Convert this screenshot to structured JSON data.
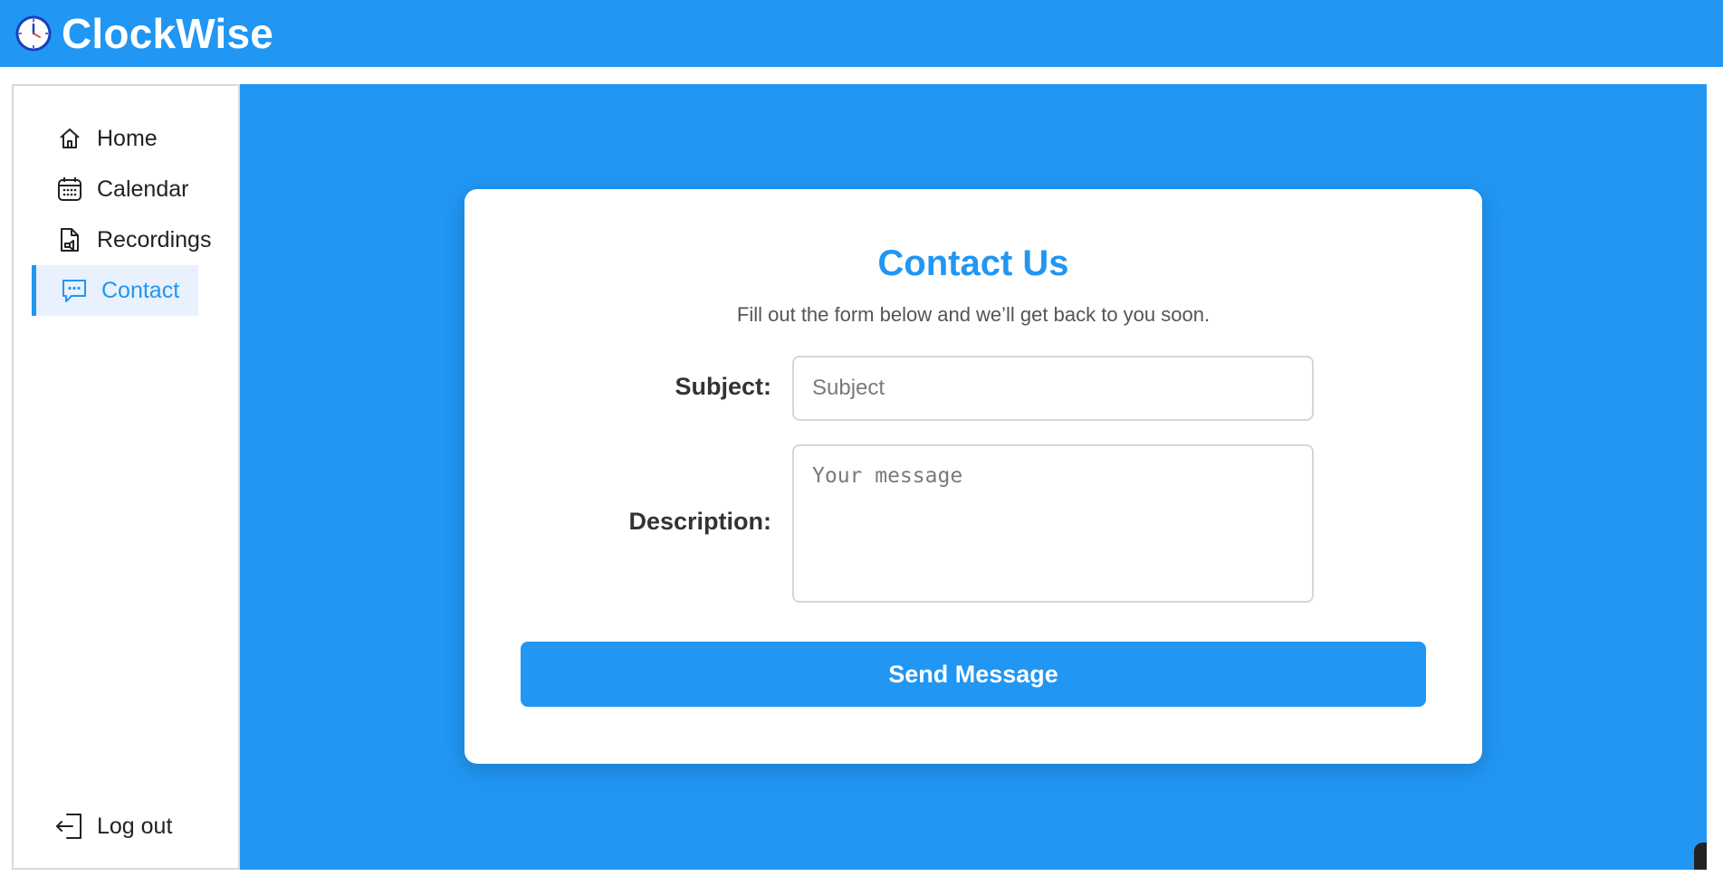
{
  "app": {
    "title": "ClockWise",
    "accent_color": "#2196f3",
    "logo_icon": "clock-icon"
  },
  "sidebar": {
    "items": [
      {
        "label": "Home",
        "icon": "home-icon",
        "active": false
      },
      {
        "label": "Calendar",
        "icon": "calendar-icon",
        "active": false
      },
      {
        "label": "Recordings",
        "icon": "recording-file-icon",
        "active": false
      },
      {
        "label": "Contact",
        "icon": "chat-icon",
        "active": true
      }
    ],
    "logout": {
      "label": "Log out",
      "icon": "logout-icon"
    }
  },
  "contact": {
    "title": "Contact Us",
    "subtitle": "Fill out the form below and we’ll get back to you soon.",
    "subject_label": "Subject:",
    "subject_placeholder": "Subject",
    "subject_value": "",
    "description_label": "Description:",
    "description_placeholder": "Your message",
    "description_value": "",
    "send_label": "Send Message"
  }
}
